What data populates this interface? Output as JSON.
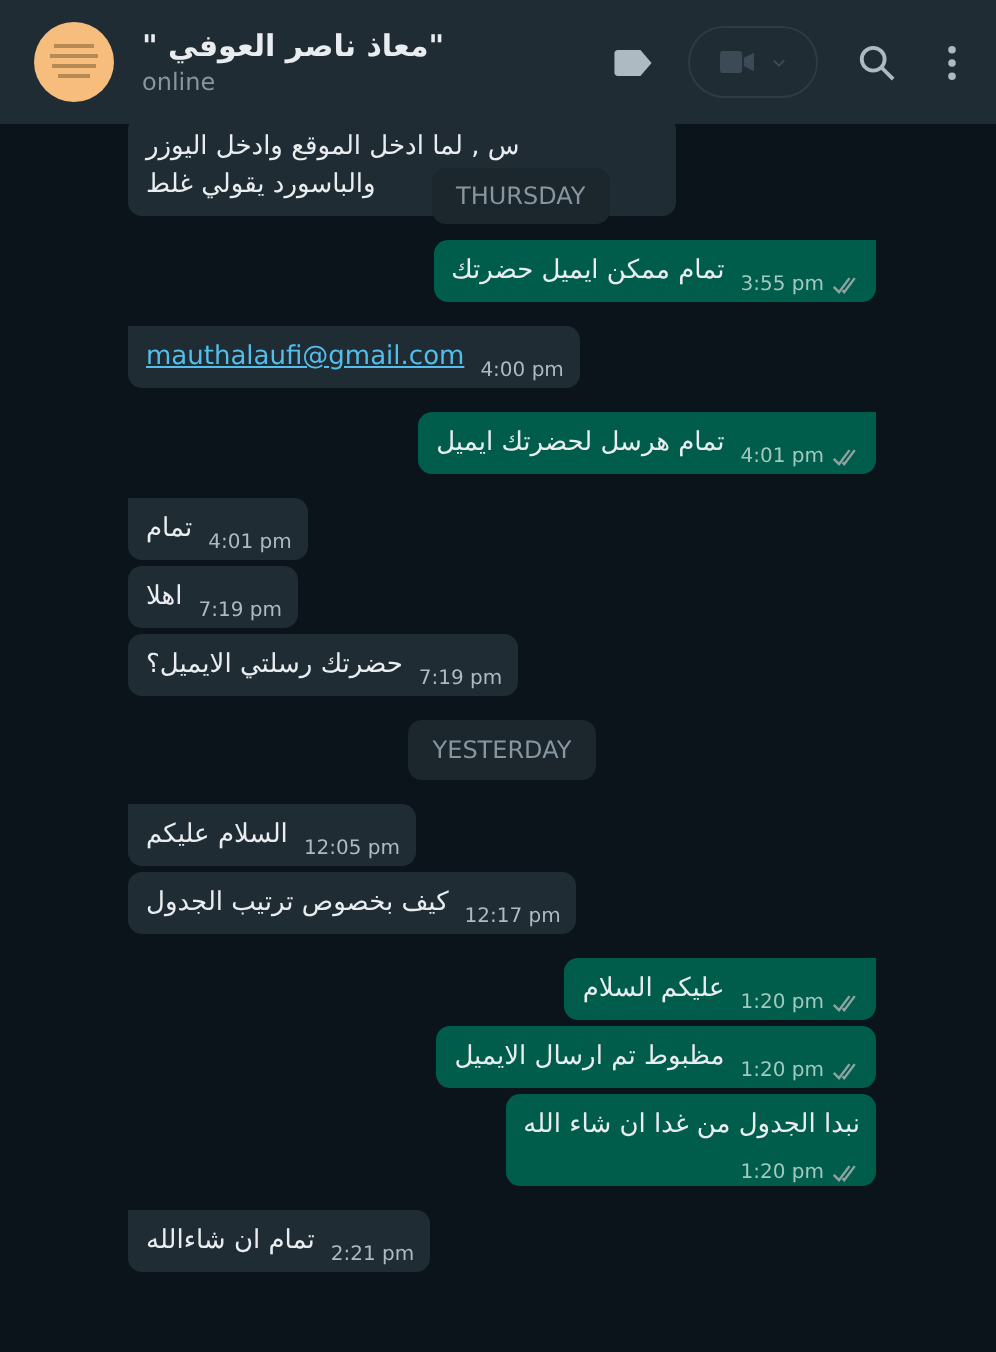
{
  "header": {
    "name": "\"معاذ ناصر العوفي \"",
    "status": "online"
  },
  "messages": [
    {
      "kind": "incoming",
      "lines": [
        "س , لما ادخل الموقع وادخل اليوزر",
        "والباسورد يقولي غلط"
      ]
    },
    {
      "kind": "outgoing",
      "group_start": true,
      "text": "تمام ممكن ايميل حضرتك",
      "time": "3:55 pm"
    },
    {
      "kind": "incoming",
      "group_start": true,
      "text": "mauthalaufi@gmail.com",
      "time": "4:00 pm",
      "link": true
    },
    {
      "kind": "outgoing",
      "group_start": true,
      "text": "تمام هرسل لحضرتك ايميل",
      "time": "4:01 pm"
    },
    {
      "kind": "incoming",
      "group_start": true,
      "text": "تمام",
      "time": "4:01 pm"
    },
    {
      "kind": "incoming",
      "group_start": false,
      "text": "اهلا",
      "time": "7:19 pm"
    },
    {
      "kind": "incoming",
      "group_start": false,
      "text": "حضرتك رسلتي الايميل؟",
      "time": "7:19 pm"
    },
    {
      "kind": "date",
      "text": "YESTERDAY"
    },
    {
      "kind": "incoming",
      "group_start": true,
      "text": "السلام عليكم",
      "time": "12:05 pm"
    },
    {
      "kind": "incoming",
      "group_start": false,
      "text": "كيف بخصوص ترتيب الجدول",
      "time": "12:17 pm"
    },
    {
      "kind": "outgoing",
      "group_start": true,
      "text": "عليكم السلام",
      "time": "1:20 pm"
    },
    {
      "kind": "outgoing",
      "group_start": false,
      "text": "مظبوط تم ارسال الايميل",
      "time": "1:20 pm"
    },
    {
      "kind": "outgoing",
      "group_start": false,
      "text": "نبدا الجدول من غدا ان شاء الله",
      "time": "1:20 pm",
      "wrap": true
    },
    {
      "kind": "incoming",
      "group_start": true,
      "text": "تمام ان شاءالله",
      "time": "2:21 pm"
    }
  ],
  "sticky_date": "THURSDAY"
}
